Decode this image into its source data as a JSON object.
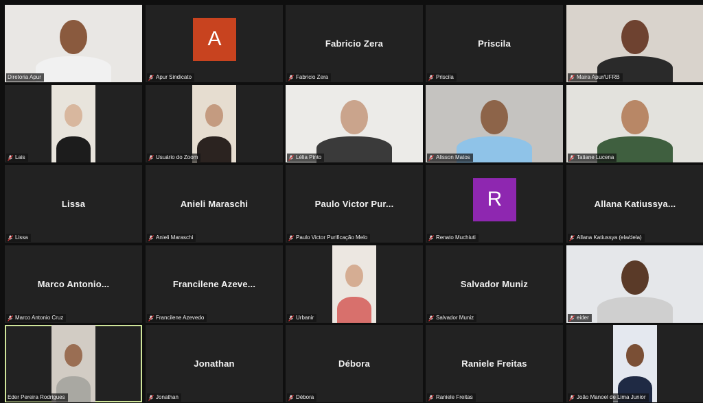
{
  "participants": [
    {
      "label": "Diretoria Apur",
      "muted": false,
      "type": "video",
      "bg": "#e9e7e4",
      "skin": "#8a5a3e",
      "shirt": "#f1f1f1"
    },
    {
      "label": "Apur Sindicato",
      "muted": true,
      "type": "avatar",
      "avatar_letter": "A",
      "avatar_color": "#c8431f"
    },
    {
      "label": "Fabricio Zera",
      "muted": true,
      "type": "name",
      "display": "Fabricio Zera"
    },
    {
      "label": "Priscila",
      "muted": true,
      "type": "name",
      "display": "Priscila"
    },
    {
      "label": "Maira Apur/UFRB",
      "muted": true,
      "type": "video",
      "bg": "#d9d3cc",
      "skin": "#6e4230",
      "shirt": "#2a2a2a"
    },
    {
      "label": "Lais",
      "muted": true,
      "type": "video-narrow",
      "bg": "#e8e4dc",
      "skin": "#d8b79e",
      "shirt": "#1c1c1c"
    },
    {
      "label": "Usuário do Zoom",
      "muted": true,
      "type": "video-narrow",
      "bg": "#e6ddd0",
      "skin": "#c49b80",
      "shirt": "#2b2320"
    },
    {
      "label": "Lélia Pinto",
      "muted": true,
      "type": "video",
      "bg": "#ecebe8",
      "skin": "#caa48c",
      "shirt": "#3a3a3a"
    },
    {
      "label": "Alisson Matos",
      "muted": true,
      "type": "video",
      "bg": "#c5c3c0",
      "skin": "#8d6449",
      "shirt": "#8fc3e8"
    },
    {
      "label": "Tatiane Lucena",
      "muted": true,
      "type": "video",
      "bg": "#e3e2dd",
      "skin": "#b88766",
      "shirt": "#3f5f3f"
    },
    {
      "label": "Lissa",
      "muted": true,
      "type": "name",
      "display": "Lissa"
    },
    {
      "label": "Anieli Maraschi",
      "muted": true,
      "type": "name",
      "display": "Anieli Maraschi"
    },
    {
      "label": "Paulo Victor Purificação Melo",
      "muted": true,
      "type": "name",
      "display": "Paulo Victor Pur..."
    },
    {
      "label": "Renato Muchiuti",
      "muted": true,
      "type": "avatar",
      "avatar_letter": "R",
      "avatar_color": "#8e27b0"
    },
    {
      "label": "Allana Katiussya (ela/dela)",
      "muted": true,
      "type": "name",
      "display": "Allana  Katiussya..."
    },
    {
      "label": "Marco Antonio Cruz",
      "muted": true,
      "type": "name",
      "display": "Marco  Antonio..."
    },
    {
      "label": "Francilene Azevedo",
      "muted": true,
      "type": "name",
      "display": "Francilene  Azeve..."
    },
    {
      "label": "Urbanir",
      "muted": true,
      "type": "video-narrow",
      "bg": "#ece7e1",
      "skin": "#d5ad93",
      "shirt": "#d8706c"
    },
    {
      "label": "Salvador Muniz",
      "muted": true,
      "type": "name",
      "display": "Salvador Muniz"
    },
    {
      "label": "eider",
      "muted": true,
      "type": "video",
      "bg": "#e5e7ea",
      "skin": "#5a3a28",
      "shirt": "#cfcfcf"
    },
    {
      "label": "Eder Pereira Rodrigues",
      "muted": false,
      "type": "video-narrow",
      "bg": "#d2ccc4",
      "skin": "#9a6e53",
      "shirt": "#a9a8a2",
      "active": true
    },
    {
      "label": "Jonathan",
      "muted": true,
      "type": "name",
      "display": "Jonathan"
    },
    {
      "label": "Débora",
      "muted": true,
      "type": "name",
      "display": "Débora"
    },
    {
      "label": "Raniele Freitas",
      "muted": true,
      "type": "name",
      "display": "Raniele Freitas"
    },
    {
      "label": "João Manoel de Lima Junior",
      "muted": true,
      "type": "video-narrow",
      "bg": "#e4e8ef",
      "skin": "#7a4f35",
      "shirt": "#1f2a44"
    }
  ]
}
